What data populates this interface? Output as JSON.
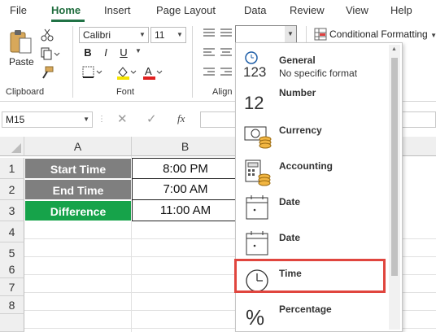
{
  "menu": {
    "items": [
      "File",
      "Home",
      "Insert",
      "Page Layout",
      "Data",
      "Review",
      "View",
      "Help"
    ],
    "active": "Home"
  },
  "ribbon": {
    "paste_label": "Paste",
    "clipboard_label": "Clipboard",
    "font_name": "Calibri",
    "font_size": "11",
    "bold": "B",
    "italic": "I",
    "underline": "U",
    "font_label": "Font",
    "alignment_label": "Align",
    "number_format_value": "",
    "conditional_formatting_label": "Conditional Formatting",
    "colors": {
      "fill": "#f5e400",
      "font": "#e02020",
      "accent": "#217346"
    }
  },
  "formula_bar": {
    "name_box": "M15",
    "fx": "fx",
    "formula": ""
  },
  "sheet": {
    "columns": [
      "A",
      "B"
    ],
    "rows": [
      "1",
      "2",
      "3",
      "4",
      "5",
      "6",
      "7",
      "8"
    ],
    "data": [
      {
        "label": "Start Time",
        "value": "8:00 PM",
        "color": "#7f7f7f"
      },
      {
        "label": "End Time",
        "value": "7:00 AM",
        "color": "#7f7f7f"
      },
      {
        "label": "Difference",
        "value": "11:00 AM",
        "color": "#16a34a"
      }
    ]
  },
  "number_format_dropdown": {
    "items": [
      {
        "name": "General",
        "sub": "No specific format",
        "icon": "general-123-icon"
      },
      {
        "name": "Number",
        "sub": "",
        "icon": "number-12-icon"
      },
      {
        "name": "Currency",
        "sub": "",
        "icon": "currency-icon"
      },
      {
        "name": "Accounting",
        "sub": "",
        "icon": "accounting-calculator-icon"
      },
      {
        "name": "Date",
        "sub": "",
        "icon": "short-date-calendar-icon"
      },
      {
        "name": "Date",
        "sub": "",
        "icon": "long-date-calendar-icon"
      },
      {
        "name": "Time",
        "sub": "",
        "icon": "clock-icon"
      },
      {
        "name": "Percentage",
        "sub": "",
        "icon": "percent-icon"
      }
    ],
    "highlighted": "Time",
    "highlight_color": "#e0453e"
  }
}
